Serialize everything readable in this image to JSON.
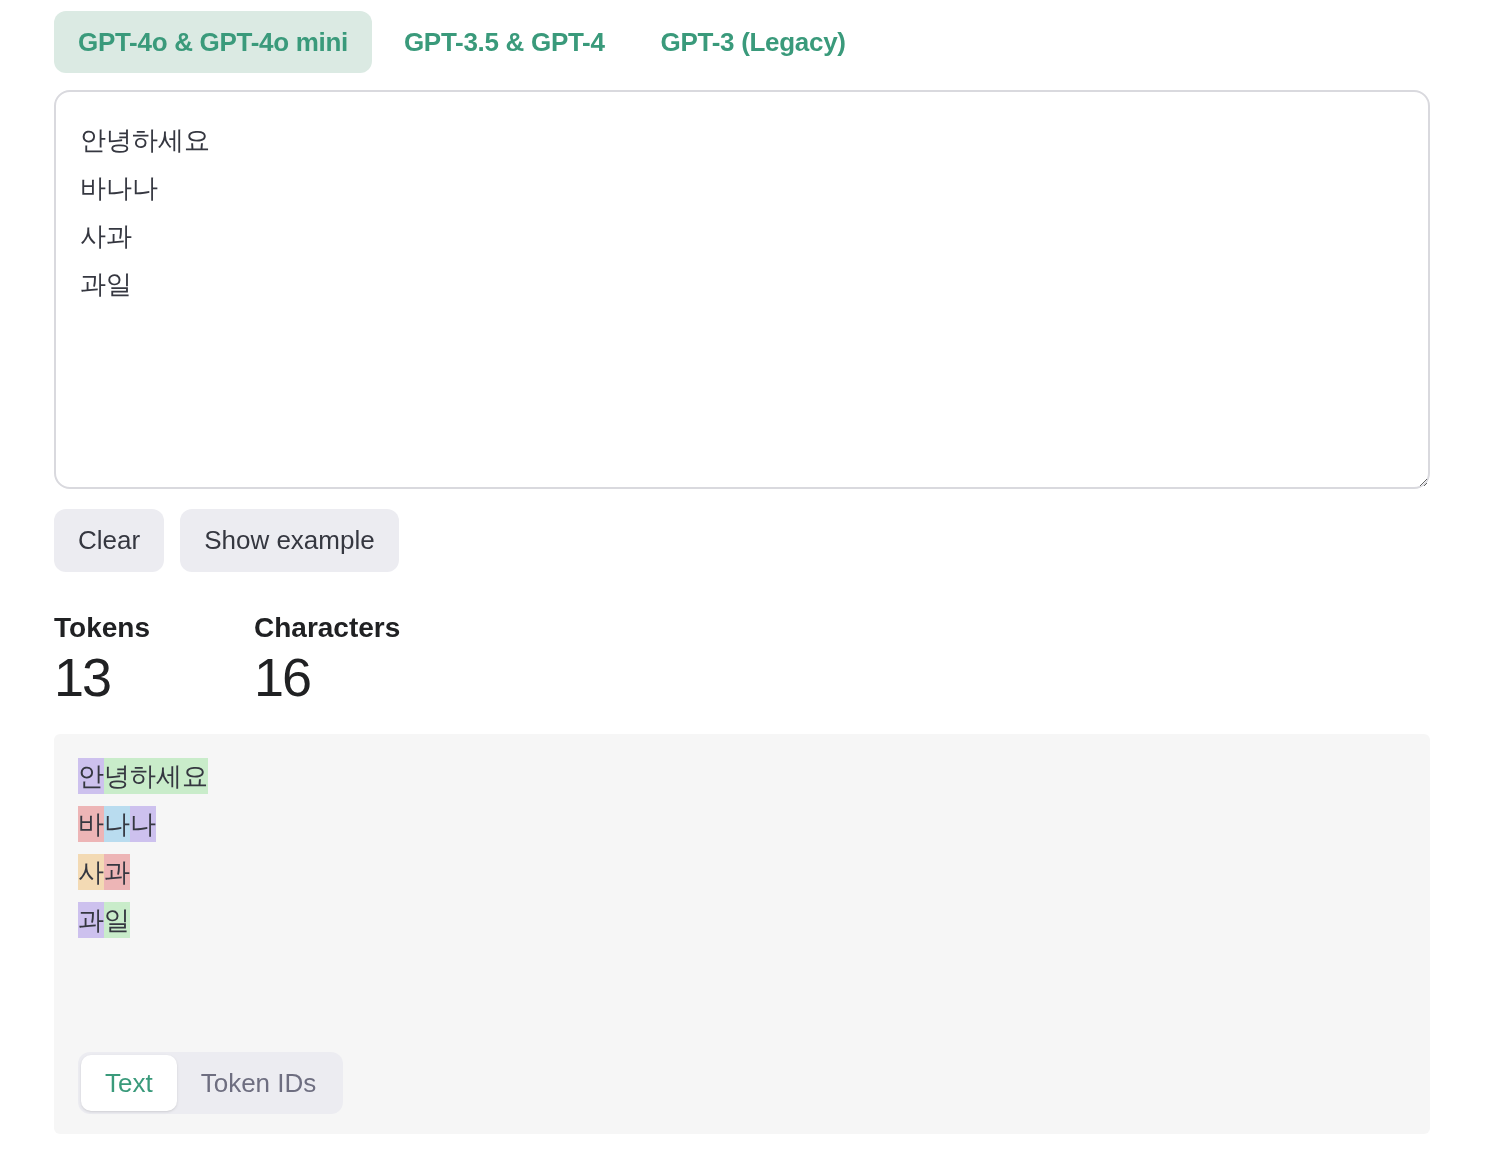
{
  "model_tabs": [
    {
      "label": "GPT-4o & GPT-4o mini",
      "selected": true
    },
    {
      "label": "GPT-3.5 & GPT-4",
      "selected": false
    },
    {
      "label": "GPT-3 (Legacy)",
      "selected": false
    }
  ],
  "input": {
    "value": "안녕하세요\n바나나\n사과\n과일"
  },
  "buttons": [
    "Clear",
    "Show example"
  ],
  "stats": [
    {
      "label": "Tokens",
      "value": "13"
    },
    {
      "label": "Characters",
      "value": "16"
    }
  ],
  "token_lines": [
    [
      {
        "text": "안",
        "color": "#cdc1ee"
      },
      {
        "text": "녕하세요",
        "color": "#c9ecca"
      }
    ],
    [
      {
        "text": "바",
        "color": "#edb5b6"
      },
      {
        "text": "나",
        "color": "#b9dcef"
      },
      {
        "text": "나",
        "color": "#cdc1ee"
      }
    ],
    [
      {
        "text": "사",
        "color": "#f3dab4"
      },
      {
        "text": "과",
        "color": "#edb5b6"
      }
    ],
    [
      {
        "text": "과",
        "color": "#cdc1ee"
      },
      {
        "text": "일",
        "color": "#c9ecca"
      }
    ]
  ],
  "view_tabs": [
    {
      "label": "Text",
      "selected": true
    },
    {
      "label": "Token IDs",
      "selected": false
    }
  ]
}
